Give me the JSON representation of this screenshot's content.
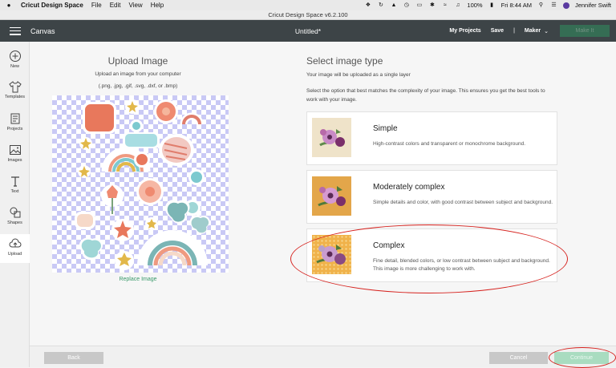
{
  "menubar": {
    "app_name": "Cricut Design Space",
    "items": [
      "File",
      "Edit",
      "View",
      "Help"
    ],
    "battery": "100%",
    "clock": "Fri 8:44 AM",
    "user": "Jennifer Swift"
  },
  "window": {
    "title": "Cricut Design Space  v6.2.100"
  },
  "header": {
    "canvas_label": "Canvas",
    "doc_title": "Untitled*",
    "my_projects": "My Projects",
    "save": "Save",
    "separator": "|",
    "machine": "Maker",
    "make_it": "Make It"
  },
  "toolbar": [
    {
      "label": "New",
      "icon": "plus-circle-icon"
    },
    {
      "label": "Templates",
      "icon": "shirt-icon"
    },
    {
      "label": "Projects",
      "icon": "projects-icon"
    },
    {
      "label": "Images",
      "icon": "image-icon"
    },
    {
      "label": "Text",
      "icon": "text-icon"
    },
    {
      "label": "Shapes",
      "icon": "shapes-icon"
    },
    {
      "label": "Upload",
      "icon": "upload-icon"
    }
  ],
  "upload": {
    "title": "Upload Image",
    "subtitle": "Upload an image from your computer",
    "formats": "(.png, .jpg, .gif, .svg, .dxf, or .bmp)",
    "replace_link": "Replace Image"
  },
  "image_type": {
    "title": "Select image type",
    "subtitle": "Your image will be uploaded as a single layer",
    "description": "Select the option that best matches the complexity of your image. This ensures you get the best tools to work with your image.",
    "options": [
      {
        "title": "Simple",
        "desc": "High-contrast colors and transparent or monochrome background."
      },
      {
        "title": "Moderately complex",
        "desc": "Simple details and color, with good contrast between subject and background."
      },
      {
        "title": "Complex",
        "desc": "Fine detail, blended colors, or low contrast between subject and background. This image is more challenging to work with."
      }
    ]
  },
  "footer": {
    "back": "Back",
    "cancel": "Cancel",
    "continue": "Continue"
  },
  "colors": {
    "header_bg": "#3d4447",
    "accent_green": "#2f8f5f",
    "annotation_red": "#d6221e"
  }
}
